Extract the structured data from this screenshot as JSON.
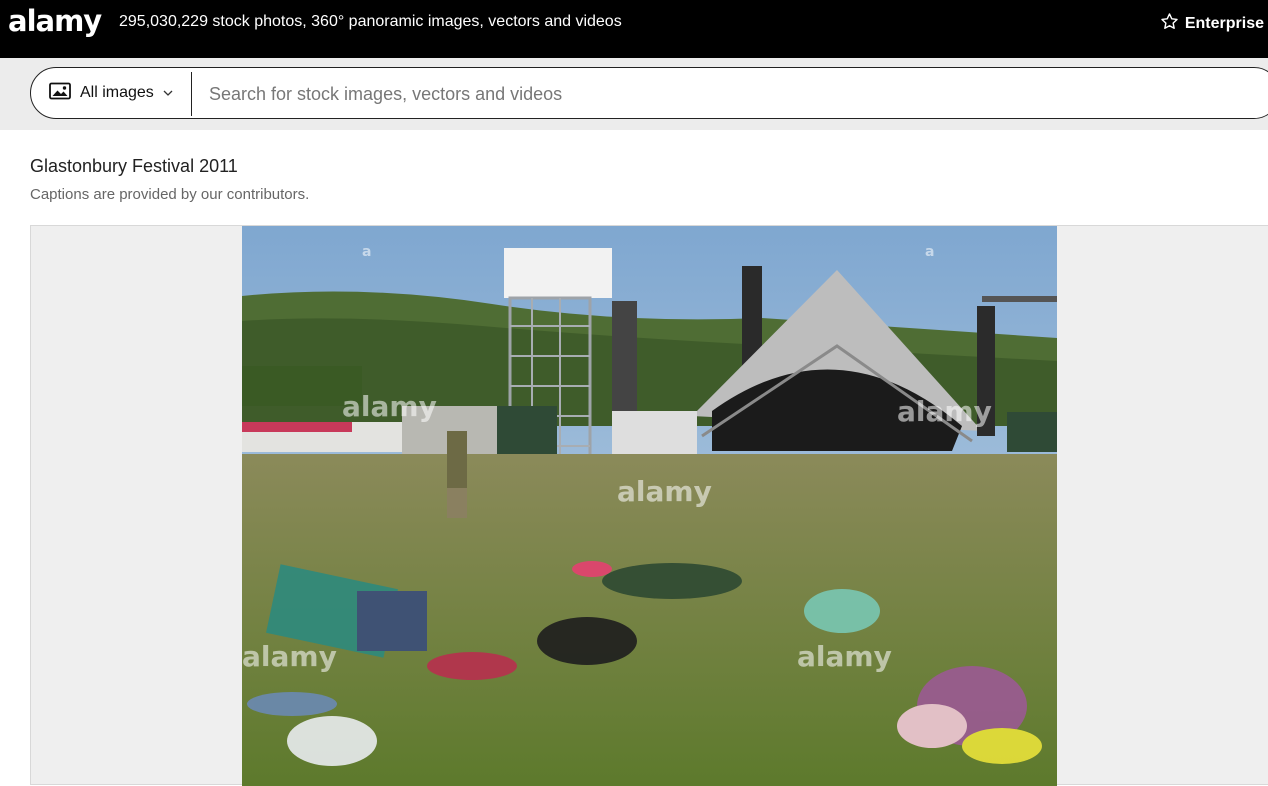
{
  "brand": {
    "logo_text": "alamy"
  },
  "header": {
    "tagline": "295,030,229 stock photos, 360° panoramic images, vectors and videos",
    "enterprise_label": "Enterprise",
    "enterprise_icon": "star-icon"
  },
  "search": {
    "scope_label": "All images",
    "scope_icon": "image-icon",
    "placeholder": "Search for stock images, vectors and videos",
    "value": ""
  },
  "image": {
    "title": "Glastonbury Festival 2011",
    "caption_note": "Captions are provided by our contributors.",
    "watermark_text": "alamy",
    "watermark_mark": "a"
  },
  "colors": {
    "header_bg": "#000000",
    "search_band_bg": "#ececec",
    "viewer_bg": "#efefef"
  }
}
